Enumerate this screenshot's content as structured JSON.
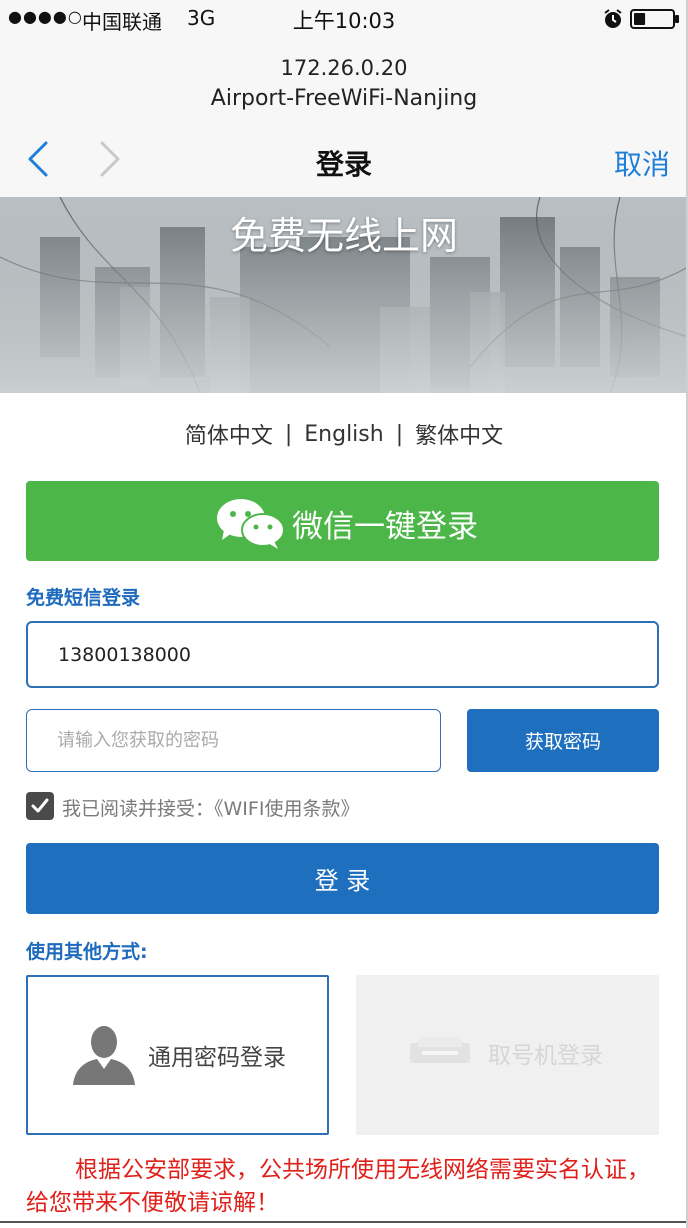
{
  "status_bar": {
    "signal": "●●●●○",
    "carrier": "中国联通",
    "network": "3G",
    "time": "上午10:03",
    "alarm_icon": "alarm-clock-icon",
    "battery_level": 0.3
  },
  "address": {
    "host": "172.26.0.20",
    "ssid": "Airport-FreeWiFi-Nanjing"
  },
  "nav": {
    "back_icon": "chevron-left-icon",
    "forward_icon": "chevron-right-icon",
    "forward_enabled": false,
    "title": "登录",
    "cancel": "取消"
  },
  "banner": {
    "title": "免费无线上网"
  },
  "languages": {
    "items": [
      "简体中文",
      "English",
      "繁体中文"
    ],
    "separator": "|"
  },
  "wechat": {
    "icon": "wechat-icon",
    "label": "微信一键登录"
  },
  "sms": {
    "section_label": "免费短信登录",
    "phone_value": "13800138000",
    "password_value": "",
    "password_placeholder": "请输入您获取的密码",
    "get_password": "获取密码",
    "agree_checked": true,
    "agree_text": "我已阅读并接受：",
    "terms_link": "《WIFI使用条款》",
    "login": "登 录"
  },
  "other": {
    "section_label": "使用其他方式:",
    "options": [
      {
        "label": "通用密码登录",
        "icon": "person-icon",
        "disabled": false
      },
      {
        "label": "取号机登录",
        "icon": "ticket-machine-icon",
        "disabled": true
      }
    ]
  },
  "notice": {
    "line1": "根据公安部要求，公共场所使用无线网络需要实名认证，",
    "line2": "给您带来不便敬请谅解！"
  },
  "colors": {
    "accent_blue": "#1f6fbf",
    "label_blue": "#1e6bbd",
    "link_blue": "#1f7fd8",
    "wechat_green": "#4cb748",
    "notice_red": "#e0201a"
  }
}
